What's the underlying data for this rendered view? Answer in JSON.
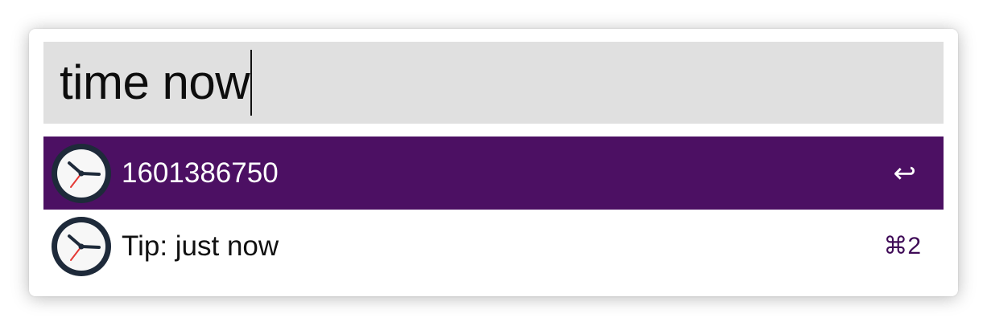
{
  "search": {
    "query": "time now"
  },
  "results": [
    {
      "title": "1601386750",
      "icon": "clock-icon",
      "shortcut": "↩",
      "selected": true
    },
    {
      "title": "Tip: just now",
      "icon": "clock-icon",
      "shortcut": "⌘2",
      "selected": false
    }
  ],
  "colors": {
    "selected_row": "#4c1063",
    "search_background": "#e0e0e0",
    "shortcut_accent": "#3f0b57"
  }
}
